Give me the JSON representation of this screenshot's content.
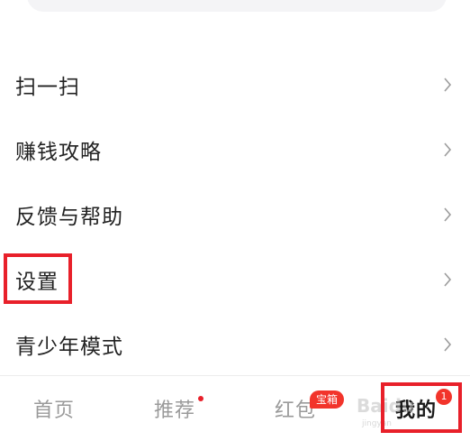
{
  "menu": {
    "items": [
      {
        "label": "扫一扫",
        "icon": "chevron-right-icon"
      },
      {
        "label": "赚钱攻略",
        "icon": "chevron-right-icon"
      },
      {
        "label": "反馈与帮助",
        "icon": "chevron-right-icon"
      },
      {
        "label": "设置",
        "icon": "chevron-right-icon",
        "highlighted": true
      },
      {
        "label": "青少年模式",
        "icon": "chevron-right-icon"
      }
    ]
  },
  "tabbar": {
    "tabs": [
      {
        "label": "首页"
      },
      {
        "label": "推荐",
        "dot": true
      },
      {
        "label": "红包",
        "badge": "宝箱"
      },
      {
        "label": "我的",
        "badge_count": "1",
        "active": true,
        "highlighted": true
      }
    ]
  },
  "watermark": {
    "text": "Baidu",
    "sub": "jingyan"
  },
  "colors": {
    "highlight": "#e8202a",
    "badge": "#f2342b",
    "inactive_tab": "#9a9a9a",
    "active_tab": "#1a1a1a"
  }
}
